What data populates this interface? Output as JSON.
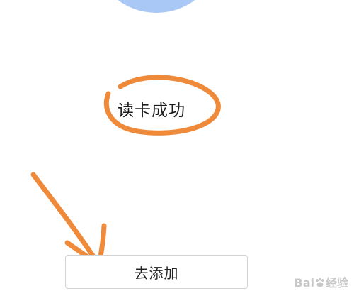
{
  "status": {
    "message": "读卡成功"
  },
  "actions": {
    "add_button_label": "去添加"
  },
  "watermark": {
    "brand_left": "Bai",
    "brand_right": "经验",
    "icon": "paw-icon"
  },
  "annotations": {
    "stroke_color": "#ef8a3a",
    "highlight": "hand-drawn-circle",
    "pointer": "hand-drawn-arrow"
  },
  "colors": {
    "top_graphic": "#a9c8f6",
    "button_border": "#d3d3d3"
  }
}
